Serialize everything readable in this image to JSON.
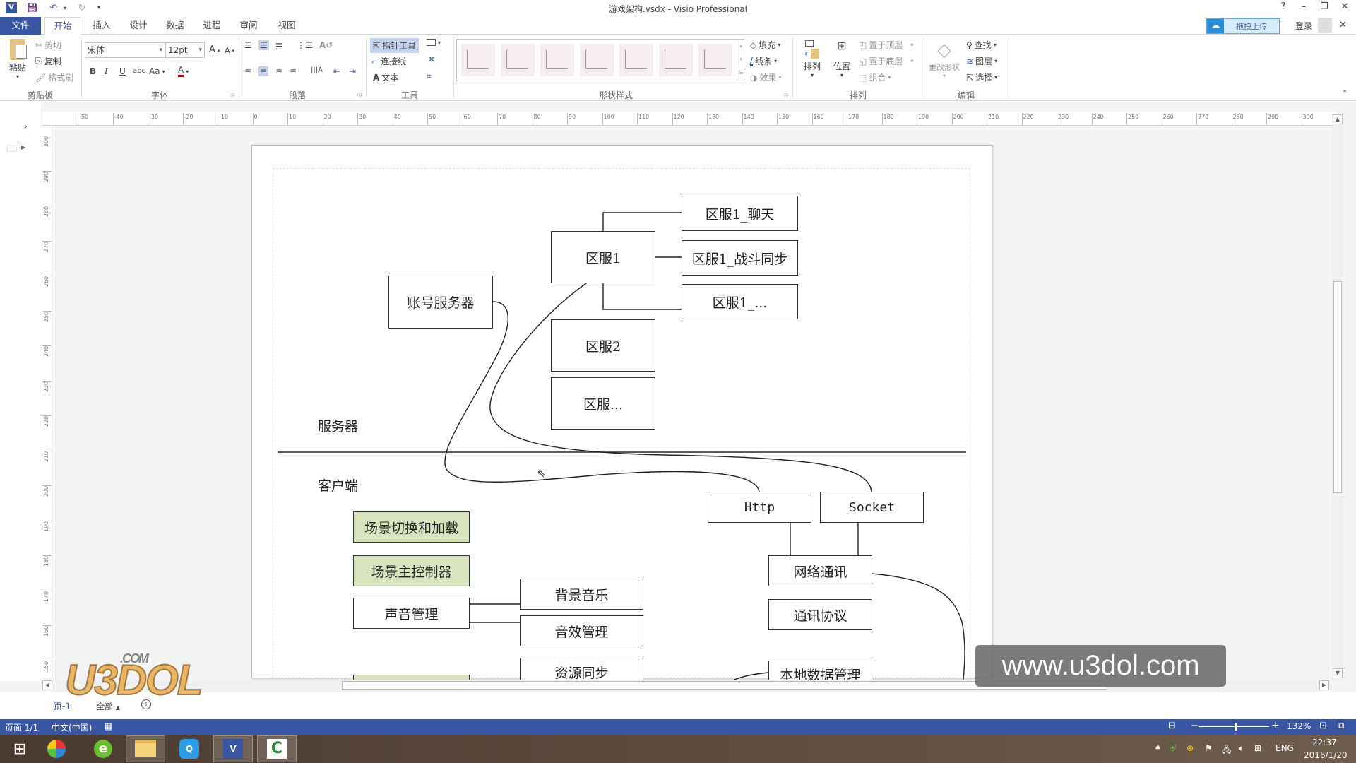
{
  "window": {
    "title": "游戏架构.vsdx - Visio Professional",
    "controls": {
      "help": "?",
      "minimize": "–",
      "restore": "❐",
      "close": "✕"
    }
  },
  "quick_access": {
    "app_icon": "visio-icon",
    "save": "save-icon",
    "undo": "undo-icon",
    "redo": "redo-icon",
    "customize": "customize-icon"
  },
  "account": {
    "upload_label": "拖拽上传",
    "signin_label": "登录"
  },
  "tabs": [
    {
      "label": "文件",
      "type": "file"
    },
    {
      "label": "开始",
      "type": "active"
    },
    {
      "label": "插入"
    },
    {
      "label": "设计"
    },
    {
      "label": "数据"
    },
    {
      "label": "进程"
    },
    {
      "label": "审阅"
    },
    {
      "label": "视图"
    }
  ],
  "ribbon": {
    "clipboard": {
      "group_label": "剪贴板",
      "paste": "粘贴",
      "cut": "剪切",
      "copy": "复制",
      "format_painter": "格式刷"
    },
    "font": {
      "group_label": "字体",
      "font_name": "宋体",
      "font_size": "12pt",
      "bold": "B",
      "italic": "I",
      "underline": "U",
      "strike": "abc",
      "case": "Aa",
      "color": "A",
      "grow": "A",
      "shrink": "A"
    },
    "paragraph": {
      "group_label": "段落"
    },
    "tools": {
      "group_label": "工具",
      "pointer": "指针工具",
      "connector": "连接线",
      "text": "文本"
    },
    "shape_styles": {
      "group_label": "形状样式",
      "fill": "填充",
      "line": "线条",
      "effects": "效果"
    },
    "arrange": {
      "group_label": "排列",
      "align": "排列",
      "position": "位置",
      "bring_front": "置于顶层",
      "send_back": "置于底层",
      "group": "组合"
    },
    "editing": {
      "group_label": "编辑",
      "change_shape": "更改形状",
      "find": "查找",
      "layers": "图层",
      "select": "选择"
    }
  },
  "rulers": {
    "horizontal": [
      "-50",
      "-40",
      "-30",
      "-20",
      "-10",
      "0",
      "10",
      "20",
      "30",
      "40",
      "50",
      "60",
      "70",
      "80",
      "90",
      "100",
      "110",
      "120",
      "130",
      "140",
      "150",
      "160",
      "170",
      "180",
      "190",
      "200",
      "210",
      "220",
      "230",
      "240",
      "250",
      "260",
      "270",
      "280",
      "290",
      "300"
    ],
    "vertical": [
      "300",
      "290",
      "280",
      "270",
      "260",
      "250",
      "240",
      "230",
      "220",
      "210",
      "200",
      "190",
      "180",
      "170",
      "160",
      "150"
    ]
  },
  "diagram": {
    "section_labels": {
      "server": "服务器",
      "client": "客户端"
    },
    "shapes": {
      "account_server": "账号服务器",
      "zone1": "区服1",
      "zone1_chat": "区服1_聊天",
      "zone1_battle": "区服1_战斗同步",
      "zone1_more": "区服1_...",
      "zone2": "区服2",
      "zone_more": "区服...",
      "scene_switch": "场景切换和加载",
      "scene_controller": "场景主控制器",
      "sound_manager": "声音管理",
      "bgm": "背景音乐",
      "sfx_manager": "音效管理",
      "resource_sync": "资源同步",
      "http": "Http",
      "socket": "Socket",
      "network": "网络通讯",
      "protocol": "通讯协议",
      "local_data": "本地数据管理"
    },
    "colors": {
      "green_fill": "#d7e4bd",
      "stroke": "#333333"
    }
  },
  "page_tabs": {
    "current": "页-1",
    "all": "全部",
    "add": "+"
  },
  "status": {
    "page": "页面 1/1",
    "language": "中文(中国)",
    "zoom": "132%"
  },
  "taskbar": {
    "apps": [
      "start-icon",
      "photo-app-icon",
      "browser-icon",
      "file-explorer-icon",
      "qq-icon",
      "visio-icon",
      "camtasia-icon"
    ],
    "tray": {
      "lang": "ENG",
      "time": "22:37",
      "date": "2016/1/20"
    }
  },
  "watermark": {
    "url": "www.u3dol.com",
    "logo": "U3DOL",
    "logo_sub": ".COM"
  }
}
